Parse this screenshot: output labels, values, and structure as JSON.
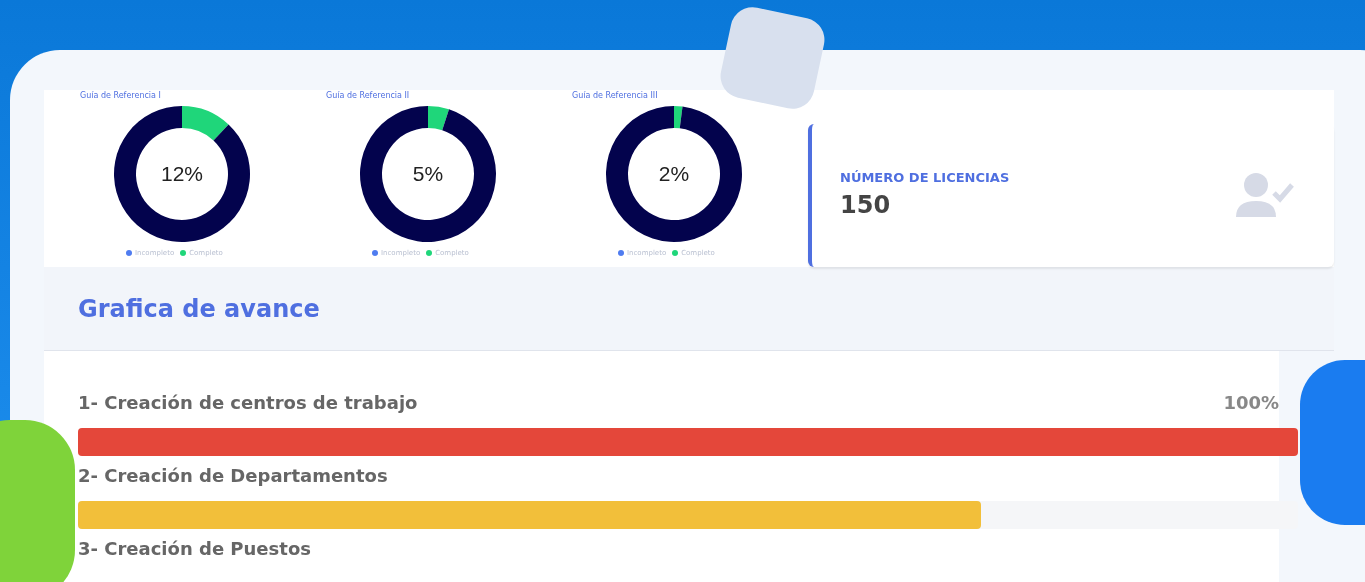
{
  "guides": [
    {
      "center_label": "12%",
      "chart_data": {
        "type": "donut",
        "title": "Guía de Referencia I",
        "categories": [
          "Incompleto",
          "Completo"
        ],
        "values": [
          88,
          12
        ],
        "colors": [
          "#03034d",
          "#1fd67a"
        ]
      },
      "legend": [
        {
          "color": "#4f7cf0"
        },
        {
          "color": "#1fd67a"
        }
      ]
    },
    {
      "center_label": "5%",
      "chart_data": {
        "type": "donut",
        "title": "Guía de Referencia II",
        "categories": [
          "Incompleto",
          "Completo"
        ],
        "values": [
          95,
          5
        ],
        "colors": [
          "#03034d",
          "#1fd67a"
        ]
      },
      "legend": [
        {
          "color": "#4f7cf0"
        },
        {
          "color": "#1fd67a"
        }
      ]
    },
    {
      "center_label": "2%",
      "chart_data": {
        "type": "donut",
        "title": "Guía de Referencia III",
        "categories": [
          "Incompleto",
          "Completo"
        ],
        "values": [
          98,
          2
        ],
        "colors": [
          "#03034d",
          "#1fd67a"
        ]
      },
      "legend": [
        {
          "color": "#4f7cf0"
        },
        {
          "color": "#1fd67a"
        }
      ]
    }
  ],
  "license_card": {
    "label": "NÚMERO DE LICENCIAS",
    "value": "150"
  },
  "progress": {
    "title": "Grafica de avance",
    "items": [
      {
        "label": "1- Creación de centros de trabajo",
        "reading": "100%",
        "level": 1,
        "color": "#e4473a"
      },
      {
        "label": "2- Creación de Departamentos",
        "level": 0.74,
        "color": "#f2bf3a"
      },
      {
        "label": "3- Creación de Puestos"
      }
    ]
  }
}
